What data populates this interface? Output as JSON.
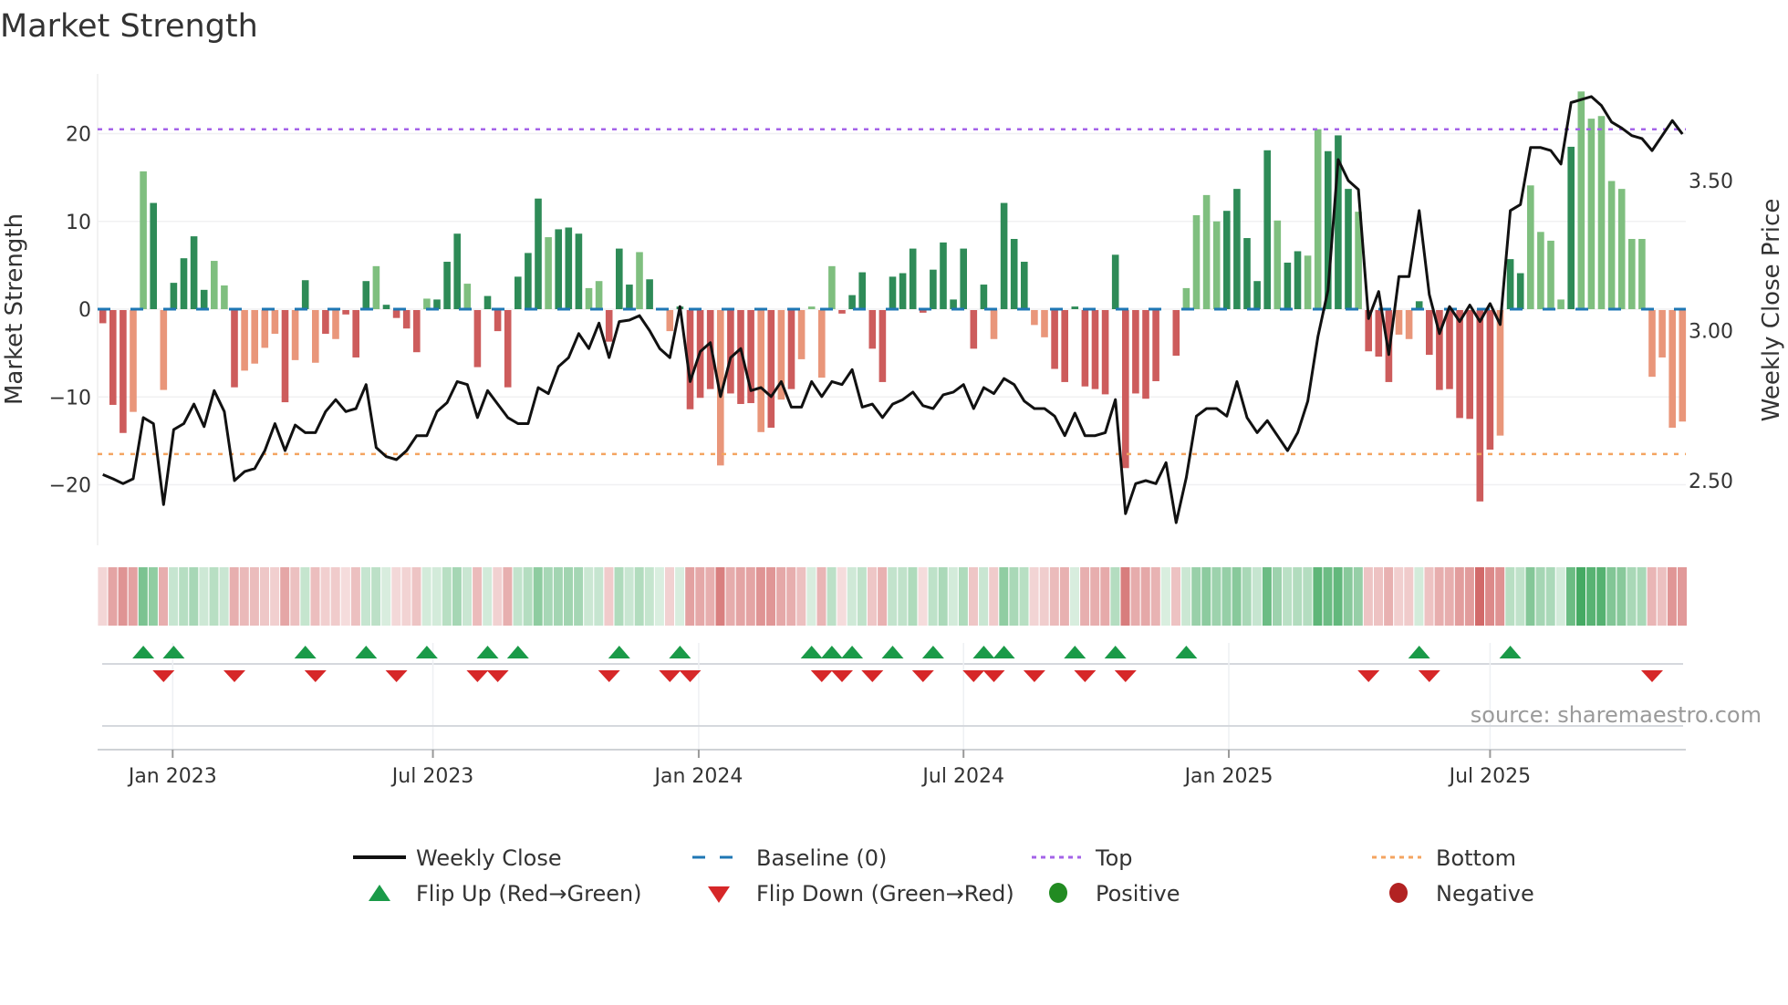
{
  "chart_data": {
    "type": "bar",
    "title": "Market Strength",
    "ylabel": "Market Strength",
    "y2label": "Weekly Close Price",
    "source": "source: sharemaestro.com",
    "ylim": [
      -27,
      29
    ],
    "y2lim": [
      2.28,
      3.98
    ],
    "yticks": [
      {
        "value": 20,
        "label": "20"
      },
      {
        "value": 10,
        "label": "10"
      },
      {
        "value": 0,
        "label": "0"
      },
      {
        "value": -10,
        "label": "−10"
      },
      {
        "value": -20,
        "label": "−20"
      }
    ],
    "y2ticks": [
      {
        "value": 3.5,
        "label": "3.50"
      },
      {
        "value": 3.0,
        "label": "3.00"
      },
      {
        "value": 2.5,
        "label": "2.50"
      }
    ],
    "xticks": [
      {
        "week": 7.9,
        "label": "Jan 2023"
      },
      {
        "week": 33.6,
        "label": "Jul 2023"
      },
      {
        "week": 59.85,
        "label": "Jan 2024"
      },
      {
        "week": 86.0,
        "label": "Jul 2024"
      },
      {
        "week": 112.2,
        "label": "Jan 2025"
      },
      {
        "week": 138.0,
        "label": "Jul 2025"
      }
    ],
    "top_level": 20.5,
    "bottom_level": -16.5,
    "baseline": 0,
    "colors": {
      "pos_strong": "#2e8b57",
      "pos_weak": "#7fbf7f",
      "neg_strong": "#cd5c5c",
      "neg_weak": "#e9967a",
      "close": "#111111",
      "baseline": "#1f77b4",
      "top": "#a463e8",
      "bottom": "#f4a460",
      "flip_up": "#1a9a48",
      "flip_down": "#d62728",
      "positive": "#228b22",
      "negative": "#b22222"
    },
    "strength": [
      -1.5,
      -10.8,
      -14,
      -11.6,
      15.7,
      12.1,
      -9.1,
      3.0,
      5.8,
      8.3,
      2.2,
      5.5,
      2.7,
      -8.8,
      -6.9,
      -6.1,
      -4.3,
      -2.7,
      -10.5,
      -5.7,
      3.3,
      -6.0,
      -2.7,
      -3.3,
      -0.5,
      -5.4,
      3.2,
      4.9,
      0.5,
      -0.9,
      -2.1,
      -4.8,
      1.2,
      1.1,
      5.4,
      8.6,
      2.9,
      -6.5,
      1.5,
      -2.4,
      -8.8,
      3.7,
      6.4,
      12.6,
      8.2,
      9.1,
      9.3,
      8.6,
      2.4,
      3.2,
      -3.6,
      6.9,
      2.8,
      6.5,
      3.4,
      0,
      -2.4,
      0.3,
      -11.3,
      -10,
      -9,
      -17.7,
      -9.5,
      -10.7,
      -10.6,
      -13.9,
      -13.4,
      -10.2,
      -9,
      -5.6,
      0.3,
      -7.7,
      4.9,
      -0.4,
      1.6,
      4.2,
      -4.4,
      -8.2,
      3.7,
      4.1,
      6.9,
      -0.3,
      4.5,
      7.6,
      1.1,
      6.9,
      -4.4,
      2.8,
      -3.3,
      12.1,
      8.0,
      5.4,
      -1.7,
      -3.1,
      -6.7,
      -8.2,
      0.3,
      -8.7,
      -9.0,
      -9.6,
      6.2,
      -18,
      -9.5,
      -10.1,
      -8.1,
      0,
      -5.2,
      2.4,
      10.7,
      13.0,
      10.0,
      11.2,
      13.7,
      8.1,
      3.2,
      18.1,
      10.1,
      5.3,
      6.6,
      6.1,
      20.5,
      18,
      19.8,
      13.7,
      11.1,
      -4.7,
      -5.3,
      -8.2,
      -2.8,
      -3.3,
      0.9,
      -5.1,
      -9.1,
      -9.0,
      -12.3,
      -12.4,
      -21.8,
      -15.9,
      -14.3,
      5.7,
      4.1,
      14.1,
      8.8,
      7.8,
      1.1,
      18.5,
      24.8,
      21.7,
      22.0,
      14.6,
      13.7,
      8.0,
      8.0,
      -7.6,
      -5.4,
      -13.4,
      -12.7
    ],
    "shade": "dddlldlddddlldlllldldldldddlddddldddldddddddldddlldddldllddddldddldldlllldddddddddddddddldddlldddddddddddddlllldddddlddlldddldddllddddddddlddlllldlll",
    "weekly_close": [
      2.52,
      2.506,
      2.49,
      2.506,
      2.71,
      2.69,
      2.42,
      2.67,
      2.69,
      2.755,
      2.68,
      2.8,
      2.73,
      2.5,
      2.53,
      2.54,
      2.6,
      2.69,
      2.6,
      2.685,
      2.66,
      2.66,
      2.73,
      2.77,
      2.73,
      2.74,
      2.82,
      2.61,
      2.58,
      2.57,
      2.6,
      2.65,
      2.65,
      2.73,
      2.76,
      2.83,
      2.82,
      2.71,
      2.8,
      2.755,
      2.71,
      2.69,
      2.69,
      2.81,
      2.79,
      2.88,
      2.91,
      2.99,
      2.94,
      3.025,
      2.91,
      3.03,
      3.035,
      3.05,
      3.0,
      2.94,
      2.91,
      3.08,
      2.83,
      2.93,
      2.96,
      2.78,
      2.91,
      2.94,
      2.8,
      2.81,
      2.78,
      2.83,
      2.745,
      2.745,
      2.83,
      2.78,
      2.83,
      2.82,
      2.87,
      2.745,
      2.755,
      2.71,
      2.755,
      2.77,
      2.795,
      2.75,
      2.74,
      2.786,
      2.795,
      2.82,
      2.74,
      2.81,
      2.79,
      2.84,
      2.82,
      2.765,
      2.74,
      2.74,
      2.715,
      2.65,
      2.725,
      2.65,
      2.65,
      2.66,
      2.77,
      2.39,
      2.49,
      2.5,
      2.49,
      2.56,
      2.36,
      2.51,
      2.715,
      2.74,
      2.74,
      2.715,
      2.83,
      2.71,
      2.66,
      2.7,
      2.65,
      2.6,
      2.66,
      2.765,
      2.98,
      3.135,
      3.57,
      3.5,
      3.47,
      3.04,
      3.13,
      2.92,
      3.18,
      3.18,
      3.4,
      3.12,
      2.99,
      3.08,
      3.03,
      3.085,
      3.03,
      3.09,
      3.02,
      3.4,
      3.42,
      3.61,
      3.61,
      3.6,
      3.555,
      3.76,
      3.77,
      3.78,
      3.75,
      3.695,
      3.675,
      3.65,
      3.64,
      3.6,
      3.65,
      3.7,
      3.655
    ],
    "flip_up_weeks": [
      5,
      8,
      21,
      27,
      33,
      39,
      42,
      52,
      58,
      71,
      73,
      75,
      79,
      83,
      88,
      90,
      97,
      101,
      108,
      131,
      140
    ],
    "flip_down_weeks": [
      7,
      14,
      22,
      30,
      38,
      40,
      51,
      57,
      59,
      72,
      74,
      77,
      82,
      87,
      89,
      93,
      98,
      102,
      126,
      132,
      154
    ],
    "legend": {
      "placement": "bottom",
      "items": [
        {
          "key": "close",
          "label": "Weekly Close",
          "symbol": "line"
        },
        {
          "key": "baseline",
          "label": "Baseline (0)",
          "symbol": "dash"
        },
        {
          "key": "top",
          "label": "Top",
          "symbol": "dot"
        },
        {
          "key": "bottom",
          "label": "Bottom",
          "symbol": "dot"
        },
        {
          "key": "flip_up",
          "label": "Flip Up (Red→Green)",
          "symbol": "up"
        },
        {
          "key": "flip_down",
          "label": "Flip Down (Green→Red)",
          "symbol": "down"
        },
        {
          "key": "positive",
          "label": "Positive",
          "symbol": "circle"
        },
        {
          "key": "negative",
          "label": "Negative",
          "symbol": "circle"
        }
      ]
    }
  }
}
